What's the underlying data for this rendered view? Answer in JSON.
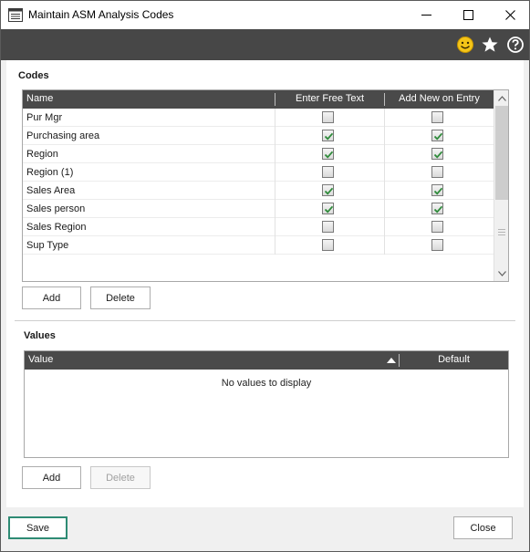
{
  "window": {
    "title": "Maintain ASM Analysis Codes",
    "icon": "app-window-icon",
    "controls": [
      "minimize-icon",
      "maximize-icon",
      "close-icon"
    ]
  },
  "toolbar": {
    "icons": [
      "smiley-face-icon",
      "star-icon",
      "help-icon"
    ],
    "accent": "#f5c518"
  },
  "codes": {
    "section_title": "Codes",
    "columns": {
      "name": "Name",
      "free_text": "Enter Free Text",
      "add_new": "Add New on Entry"
    },
    "rows": [
      {
        "name": "Pur Mgr",
        "free_text": false,
        "add_new": false
      },
      {
        "name": "Purchasing area",
        "free_text": true,
        "add_new": true
      },
      {
        "name": "Region",
        "free_text": true,
        "add_new": true
      },
      {
        "name": "Region (1)",
        "free_text": false,
        "add_new": false
      },
      {
        "name": "Sales Area",
        "free_text": true,
        "add_new": true
      },
      {
        "name": "Sales person",
        "free_text": true,
        "add_new": true
      },
      {
        "name": "Sales Region",
        "free_text": false,
        "add_new": false
      },
      {
        "name": "Sup Type",
        "free_text": false,
        "add_new": false
      }
    ],
    "add_label": "Add",
    "delete_label": "Delete"
  },
  "values": {
    "section_title": "Values",
    "columns": {
      "value": "Value",
      "default": "Default"
    },
    "sort_indicator": "sort-ascending-icon",
    "empty_message": "No values to display",
    "add_label": "Add",
    "delete_label": "Delete",
    "delete_enabled": false
  },
  "footer": {
    "save_label": "Save",
    "close_label": "Close",
    "save_border_color": "#2e8b74"
  },
  "colors": {
    "header_bg": "#4a4a4a",
    "toolbar_bg": "#474747",
    "check_color": "#2e8b3a"
  }
}
